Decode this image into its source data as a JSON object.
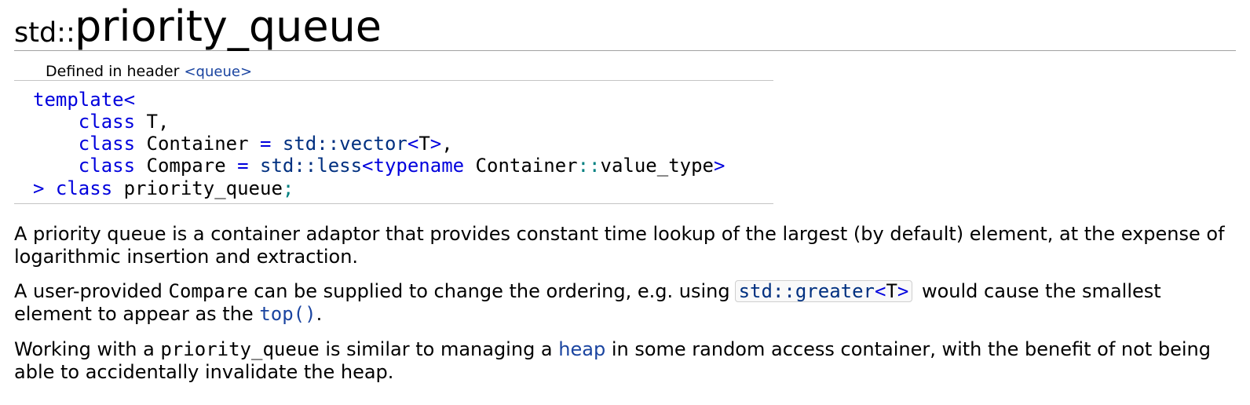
{
  "title": {
    "prefix": "std::",
    "name": "priority_queue"
  },
  "header": {
    "label": "Defined in header",
    "link": "<queue>"
  },
  "declaration": {
    "l1_kw": "template",
    "l1_op": "<",
    "l2_kw": "class",
    "l2_rest": " T,",
    "l3_kw": "class",
    "l3_name": " Container ",
    "l3_eq": "=",
    "l3_lib": "std::vector",
    "l3_lt": "<",
    "l3_t": "T",
    "l3_gt": ">",
    "l3_comma": ",",
    "l4_kw": "class",
    "l4_name": " Compare ",
    "l4_eq": "=",
    "l4_lib": "std::less",
    "l4_lt": "<",
    "l4_typename": "typename",
    "l4_container": " Container",
    "l4_scope": "::",
    "l4_member": "value_type",
    "l4_gt": ">",
    "l5_gt": ">",
    "l5_kw": "class",
    "l5_name": " priority_queue",
    "l5_semi": ";"
  },
  "description": {
    "p1": "A priority queue is a container adaptor that provides constant time lookup of the largest (by default) element, at the expense of logarithmic insertion and extraction.",
    "p2_a": "A user-provided ",
    "p2_compare": "Compare",
    "p2_b": " can be supplied to change the ordering, e.g. using",
    "p2_code_lib": "std::greater",
    "p2_code_lt": "<",
    "p2_code_t": "T",
    "p2_code_gt": ">",
    "p2_c": " would cause the smallest element to appear as the ",
    "p2_top": "top()",
    "p2_d": ".",
    "p3_a": "Working with a ",
    "p3_pq": "priority_queue",
    "p3_b": " is similar to managing a ",
    "p3_heap": "heap",
    "p3_c": " in some random access container, with the benefit of not being able to accidentally invalidate the heap."
  }
}
